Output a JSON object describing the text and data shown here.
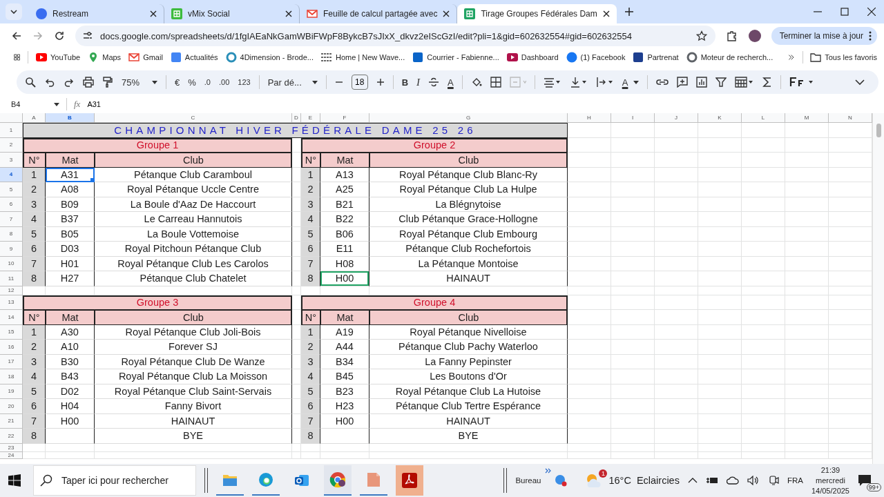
{
  "browser": {
    "tabs": [
      {
        "title": "Restream",
        "kind": "restream",
        "selected": false
      },
      {
        "title": "vMix Social",
        "kind": "vmix",
        "selected": false
      },
      {
        "title": "Feuille de calcul partagée avec",
        "kind": "gmail",
        "selected": false
      },
      {
        "title": "Tirage Groupes Fédérales Dam",
        "kind": "sheets",
        "selected": true
      }
    ],
    "url": "docs.google.com/spreadsheets/d/1fgIAEaNkGamWBiFWpF8BykcB7sJIxX_dkvz2eIScGzI/edit?pli=1&gid=602632554#gid=602632554",
    "update_button": "Terminer la mise à jour",
    "bookmarks": [
      {
        "label": "YouTube",
        "kind": "youtube"
      },
      {
        "label": "Maps",
        "kind": "maps"
      },
      {
        "label": "Gmail",
        "kind": "gmail"
      },
      {
        "label": "Actualités",
        "kind": "news"
      },
      {
        "label": "4Dimension - Brode...",
        "kind": "dimension"
      },
      {
        "label": "Home | New Wave...",
        "kind": "wave"
      },
      {
        "label": "Courrier - Fabienne...",
        "kind": "outlook"
      },
      {
        "label": "Dashboard",
        "kind": "dashboard"
      },
      {
        "label": "(1) Facebook",
        "kind": "facebook"
      },
      {
        "label": "Partrenat",
        "kind": "partrenat"
      },
      {
        "label": "Moteur de recherch...",
        "kind": "globe"
      }
    ],
    "all_bookmarks": "Tous les favoris"
  },
  "toolbar": {
    "zoom": "75%",
    "currency": "€",
    "percent": "%",
    "decrease_decimals": ".0",
    "increase_decimals": ".00",
    "number_format": "123",
    "font": "Par dé...",
    "font_size": "18",
    "bold": "B",
    "italic": "I",
    "text_color": "A",
    "text_rotation": "A"
  },
  "formula_bar": {
    "cell": "B4",
    "fx": "fx",
    "value": "A31"
  },
  "sheet": {
    "column_headers": [
      {
        "label": "A",
        "selected": false
      },
      {
        "label": "B",
        "selected": true
      },
      {
        "label": "C",
        "selected": false
      },
      {
        "label": "D",
        "selected": false
      },
      {
        "label": "E",
        "selected": false
      },
      {
        "label": "F",
        "selected": false
      },
      {
        "label": "G",
        "selected": false
      },
      {
        "label": "H",
        "selected": false
      },
      {
        "label": "I",
        "selected": false
      },
      {
        "label": "J",
        "selected": false
      },
      {
        "label": "K",
        "selected": false
      },
      {
        "label": "L",
        "selected": false
      },
      {
        "label": "M",
        "selected": false
      },
      {
        "label": "N",
        "selected": false
      }
    ],
    "row_headers": [
      {
        "label": "1",
        "selected": false
      },
      {
        "label": "2",
        "selected": false
      },
      {
        "label": "3",
        "selected": false
      },
      {
        "label": "4",
        "selected": true
      },
      {
        "label": "5",
        "selected": false
      },
      {
        "label": "6",
        "selected": false
      },
      {
        "label": "7",
        "selected": false
      },
      {
        "label": "8",
        "selected": false
      },
      {
        "label": "9",
        "selected": false
      },
      {
        "label": "10",
        "selected": false
      },
      {
        "label": "11",
        "selected": false
      },
      {
        "label": "12",
        "selected": false
      },
      {
        "label": "13",
        "selected": false
      },
      {
        "label": "14",
        "selected": false
      },
      {
        "label": "15",
        "selected": false
      },
      {
        "label": "16",
        "selected": false
      },
      {
        "label": "17",
        "selected": false
      },
      {
        "label": "18",
        "selected": false
      },
      {
        "label": "19",
        "selected": false
      },
      {
        "label": "20",
        "selected": false
      },
      {
        "label": "21",
        "selected": false
      },
      {
        "label": "22",
        "selected": false
      },
      {
        "label": "23",
        "selected": false
      },
      {
        "label": "24",
        "selected": false
      }
    ],
    "title": "CHAMPIONNAT HIVER FÉDÉRALE DAME 25 26",
    "groups": [
      {
        "title": "Groupe 1",
        "headers": [
          "N°",
          "Mat",
          "Club"
        ],
        "rows": [
          {
            "n": "1",
            "mat": "A31",
            "club": "Pétanque Club Caramboul",
            "selected": true,
            "remote_cursor": false
          },
          {
            "n": "2",
            "mat": "A08",
            "club": "Royal Pétanque Uccle Centre",
            "selected": false,
            "remote_cursor": false
          },
          {
            "n": "3",
            "mat": "B09",
            "club": "La Boule d'Aaz De Haccourt",
            "selected": false,
            "remote_cursor": false
          },
          {
            "n": "4",
            "mat": "B37",
            "club": "Le Carreau Hannutois",
            "selected": false,
            "remote_cursor": false
          },
          {
            "n": "5",
            "mat": "B05",
            "club": "La Boule Vottemoise",
            "selected": false,
            "remote_cursor": false
          },
          {
            "n": "6",
            "mat": "D03",
            "club": "Royal Pitchoun Pétanque Club",
            "selected": false,
            "remote_cursor": false
          },
          {
            "n": "7",
            "mat": "H01",
            "club": "Royal Pétanque Club Les Carolos",
            "selected": false,
            "remote_cursor": false
          },
          {
            "n": "8",
            "mat": "H27",
            "club": "Pétanque Club Chatelet",
            "selected": false,
            "remote_cursor": false
          }
        ]
      },
      {
        "title": "Groupe 2",
        "headers": [
          "N°",
          "Mat",
          "Club"
        ],
        "rows": [
          {
            "n": "1",
            "mat": "A13",
            "club": "Royal Pétanque Club Blanc-Ry",
            "selected": false,
            "remote_cursor": false
          },
          {
            "n": "2",
            "mat": "A25",
            "club": "Royal Pétanque Club La Hulpe",
            "selected": false,
            "remote_cursor": false
          },
          {
            "n": "3",
            "mat": "B21",
            "club": "La Blégnytoise",
            "selected": false,
            "remote_cursor": false
          },
          {
            "n": "4",
            "mat": "B22",
            "club": "Club Pétanque Grace-Hollogne",
            "selected": false,
            "remote_cursor": false
          },
          {
            "n": "5",
            "mat": "B06",
            "club": "Royal Pétanque Club Embourg",
            "selected": false,
            "remote_cursor": false
          },
          {
            "n": "6",
            "mat": "E11",
            "club": "Pétanque Club Rochefortois",
            "selected": false,
            "remote_cursor": false
          },
          {
            "n": "7",
            "mat": "H08",
            "club": "La Pétanque Montoise",
            "selected": false,
            "remote_cursor": false
          },
          {
            "n": "8",
            "mat": "H00",
            "club": "HAINAUT",
            "selected": false,
            "remote_cursor": true
          }
        ]
      },
      {
        "title": "Groupe 3",
        "headers": [
          "N°",
          "Mat",
          "Club"
        ],
        "rows": [
          {
            "n": "1",
            "mat": "A30",
            "club": "Royal Pétanque Club Joli-Bois",
            "selected": false,
            "remote_cursor": false
          },
          {
            "n": "2",
            "mat": "A10",
            "club": "Forever SJ",
            "selected": false,
            "remote_cursor": false
          },
          {
            "n": "3",
            "mat": "B30",
            "club": "Royal Pétanque Club De Wanze",
            "selected": false,
            "remote_cursor": false
          },
          {
            "n": "4",
            "mat": "B43",
            "club": "Royal Pétanque Club La Moisson",
            "selected": false,
            "remote_cursor": false
          },
          {
            "n": "5",
            "mat": "D02",
            "club": "Royal Pétanque Club Saint-Servais",
            "selected": false,
            "remote_cursor": false
          },
          {
            "n": "6",
            "mat": "H04",
            "club": "Fanny Bivort",
            "selected": false,
            "remote_cursor": false
          },
          {
            "n": "7",
            "mat": "H00",
            "club": "HAINAUT",
            "selected": false,
            "remote_cursor": false
          },
          {
            "n": "8",
            "club": "BYE",
            "selected": false,
            "remote_cursor": false
          }
        ]
      },
      {
        "title": "Groupe 4",
        "headers": [
          "N°",
          "Mat",
          "Club"
        ],
        "rows": [
          {
            "n": "1",
            "mat": "A19",
            "club": "Royal Pétanque Nivelloise",
            "selected": false,
            "remote_cursor": false
          },
          {
            "n": "2",
            "mat": "A44",
            "club": "Pétanque Club Pachy Waterloo",
            "selected": false,
            "remote_cursor": false
          },
          {
            "n": "3",
            "mat": "B34",
            "club": "La Fanny Pepinster",
            "selected": false,
            "remote_cursor": false
          },
          {
            "n": "4",
            "mat": "B45",
            "club": "Les Boutons d'Or",
            "selected": false,
            "remote_cursor": false
          },
          {
            "n": "5",
            "mat": "B23",
            "club": "Royal Pétanque Club La Hutoise",
            "selected": false,
            "remote_cursor": false
          },
          {
            "n": "6",
            "mat": "H23",
            "club": "Pétanque Club Tertre Espérance",
            "selected": false,
            "remote_cursor": false
          },
          {
            "n": "7",
            "mat": "H00",
            "club": "HAINAUT",
            "selected": false,
            "remote_cursor": false
          },
          {
            "n": "8",
            "club": "BYE",
            "selected": false,
            "remote_cursor": false
          }
        ]
      }
    ]
  },
  "taskbar": {
    "search_placeholder": "Taper ici pour rechercher",
    "desktop": "Bureau",
    "weather_badge": "1",
    "temperature": "16°C",
    "weather": "Eclaircies",
    "language": "FRA",
    "time": "21:39",
    "day": "mercredi",
    "date": "14/05/2025",
    "notifications": "99+"
  }
}
